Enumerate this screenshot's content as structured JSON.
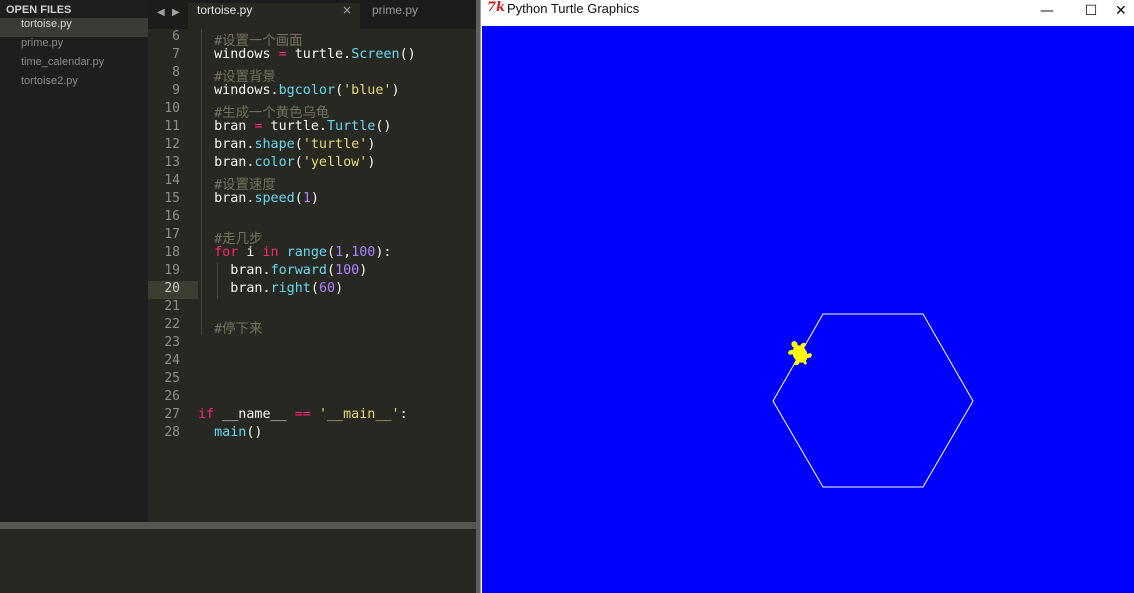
{
  "sidebar": {
    "header": "OPEN FILES",
    "files": [
      {
        "label": "tortoise.py",
        "active": true
      },
      {
        "label": "prime.py",
        "active": false
      },
      {
        "label": "time_calendar.py",
        "active": false
      },
      {
        "label": "tortoise2.py",
        "active": false
      }
    ]
  },
  "tabs": {
    "prev_arrow": "◀",
    "next_arrow": "▶",
    "active": {
      "label": "tortoise.py",
      "close_icon": "×"
    },
    "inactive": {
      "label": "prime.py"
    }
  },
  "editor": {
    "current_line": "20",
    "lines": [
      {
        "num": "6",
        "tokens": [
          {
            "t": "  "
          },
          {
            "t": "#设置一个画面",
            "c": "comment"
          }
        ]
      },
      {
        "num": "7",
        "tokens": [
          {
            "t": "  windows "
          },
          {
            "t": "=",
            "c": "kw"
          },
          {
            "t": " turtle."
          },
          {
            "t": "Screen",
            "c": "fn"
          },
          {
            "t": "()"
          }
        ]
      },
      {
        "num": "8",
        "tokens": [
          {
            "t": "  "
          },
          {
            "t": "#设置背景",
            "c": "comment"
          }
        ]
      },
      {
        "num": "9",
        "tokens": [
          {
            "t": "  windows."
          },
          {
            "t": "bgcolor",
            "c": "fn"
          },
          {
            "t": "("
          },
          {
            "t": "'blue'",
            "c": "str"
          },
          {
            "t": ")"
          }
        ]
      },
      {
        "num": "10",
        "tokens": [
          {
            "t": "  "
          },
          {
            "t": "#生成一个黄色乌龟",
            "c": "comment"
          }
        ]
      },
      {
        "num": "11",
        "tokens": [
          {
            "t": "  bran "
          },
          {
            "t": "=",
            "c": "kw"
          },
          {
            "t": " turtle."
          },
          {
            "t": "Turtle",
            "c": "fn"
          },
          {
            "t": "()"
          }
        ]
      },
      {
        "num": "12",
        "tokens": [
          {
            "t": "  bran."
          },
          {
            "t": "shape",
            "c": "fn"
          },
          {
            "t": "("
          },
          {
            "t": "'turtle'",
            "c": "str"
          },
          {
            "t": ")"
          }
        ]
      },
      {
        "num": "13",
        "tokens": [
          {
            "t": "  bran."
          },
          {
            "t": "color",
            "c": "fn"
          },
          {
            "t": "("
          },
          {
            "t": "'yellow'",
            "c": "str"
          },
          {
            "t": ")"
          }
        ]
      },
      {
        "num": "14",
        "tokens": [
          {
            "t": "  "
          },
          {
            "t": "#设置速度",
            "c": "comment"
          }
        ]
      },
      {
        "num": "15",
        "tokens": [
          {
            "t": "  bran."
          },
          {
            "t": "speed",
            "c": "fn"
          },
          {
            "t": "("
          },
          {
            "t": "1",
            "c": "num"
          },
          {
            "t": ")"
          }
        ]
      },
      {
        "num": "16",
        "tokens": []
      },
      {
        "num": "17",
        "tokens": [
          {
            "t": "  "
          },
          {
            "t": "#走几步",
            "c": "comment"
          }
        ]
      },
      {
        "num": "18",
        "tokens": [
          {
            "t": "  "
          },
          {
            "t": "for",
            "c": "kw"
          },
          {
            "t": " i "
          },
          {
            "t": "in",
            "c": "kw"
          },
          {
            "t": " "
          },
          {
            "t": "range",
            "c": "fn"
          },
          {
            "t": "("
          },
          {
            "t": "1",
            "c": "num"
          },
          {
            "t": ","
          },
          {
            "t": "100",
            "c": "num"
          },
          {
            "t": "):"
          }
        ]
      },
      {
        "num": "19",
        "tokens": [
          {
            "t": "    bran."
          },
          {
            "t": "forward",
            "c": "fn"
          },
          {
            "t": "("
          },
          {
            "t": "100",
            "c": "num"
          },
          {
            "t": ")"
          }
        ]
      },
      {
        "num": "20",
        "tokens": [
          {
            "t": "    bran."
          },
          {
            "t": "right",
            "c": "fn"
          },
          {
            "t": "("
          },
          {
            "t": "60",
            "c": "num"
          },
          {
            "t": ")"
          }
        ]
      },
      {
        "num": "21",
        "tokens": []
      },
      {
        "num": "22",
        "tokens": [
          {
            "t": "  "
          },
          {
            "t": "#停下来",
            "c": "comment"
          }
        ]
      },
      {
        "num": "23",
        "tokens": []
      },
      {
        "num": "24",
        "tokens": []
      },
      {
        "num": "25",
        "tokens": []
      },
      {
        "num": "26",
        "tokens": []
      },
      {
        "num": "27",
        "tokens": [
          {
            "t": "if",
            "c": "kw"
          },
          {
            "t": " __name__ "
          },
          {
            "t": "==",
            "c": "kw"
          },
          {
            "t": " "
          },
          {
            "t": "'__main__'",
            "c": "str"
          },
          {
            "t": ":"
          }
        ]
      },
      {
        "num": "28",
        "tokens": [
          {
            "t": "  "
          },
          {
            "t": "main",
            "c": "fn"
          },
          {
            "t": "()"
          }
        ]
      }
    ]
  },
  "turtle_window": {
    "logo": "7k",
    "title": "Python Turtle Graphics",
    "minimize_icon": "—",
    "maximize_icon": "☐",
    "close_icon": "✕",
    "canvas_color": "#0000ff",
    "pen_color": "#ffffff",
    "turtle_color": "#ffff00"
  },
  "colors": {
    "editor_bg": "#272822",
    "sidebar_bg": "#1e1f1c",
    "comment": "#75715e",
    "keyword": "#f92672",
    "function": "#66d9ef",
    "string": "#e6db74",
    "number": "#ae81ff"
  }
}
